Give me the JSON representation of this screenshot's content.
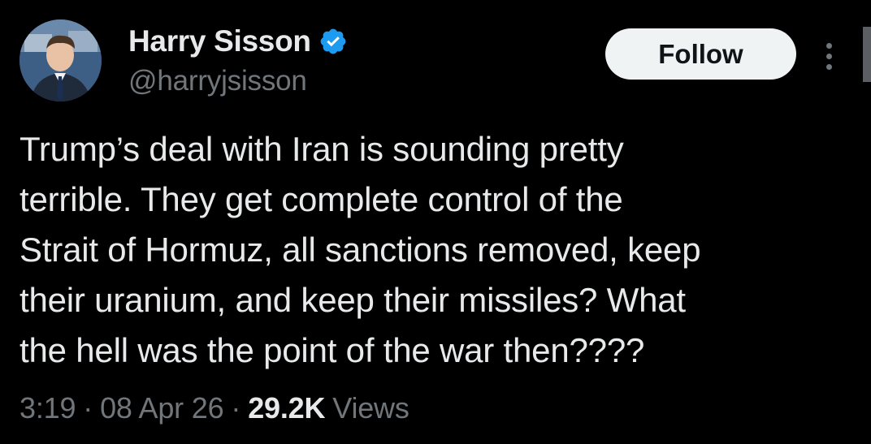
{
  "author": {
    "display_name": "Harry Sisson",
    "handle": "@harryjsisson",
    "verified_icon": "verified-badge-icon",
    "avatar_alt": "profile-photo"
  },
  "actions": {
    "follow_label": "Follow",
    "more_icon": "more-vertical-icon"
  },
  "tweet": {
    "text": "Trump’s deal with Iran is sounding pretty\nterrible. They get complete control of the\nStrait of Hormuz, all sanctions removed, keep\ntheir uranium, and keep their missiles? What\nthe hell was the point of the war then????"
  },
  "meta": {
    "time": "3:19",
    "separator": "·",
    "date": "08 Apr 26",
    "views_count": "29.2K",
    "views_label": "Views"
  },
  "colors": {
    "background": "#000000",
    "primary_text": "#e7e9ea",
    "secondary_text": "#71767b",
    "verified_blue": "#1d9bf0",
    "follow_bg": "#eff3f4"
  }
}
